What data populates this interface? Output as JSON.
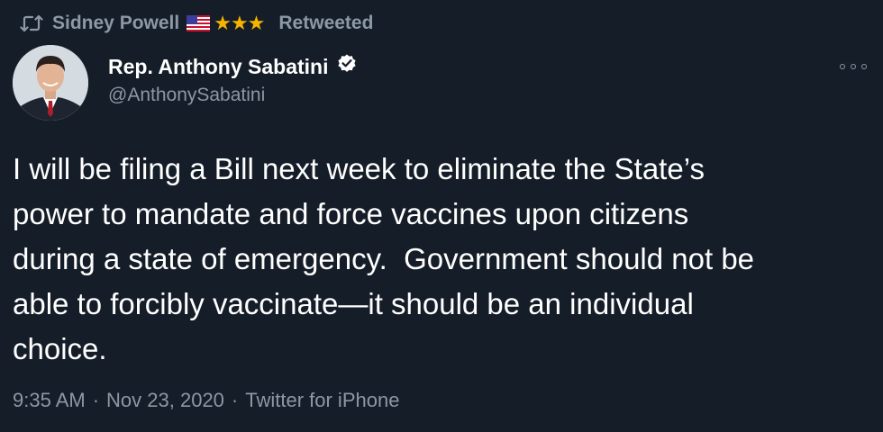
{
  "retweet": {
    "user": "Sidney Powell",
    "stars": "★★★",
    "label": "Retweeted"
  },
  "author": {
    "name": "Rep. Anthony Sabatini",
    "handle": "@AnthonySabatini",
    "verified": true
  },
  "tweet": {
    "text": "I will be filing a Bill next week to eliminate the State’s\npower to mandate and force vaccines upon citizens\nduring a state of emergency.  Government should not be\nable to forcibly vaccinate—it should be an individual\nchoice.",
    "time": "9:35 AM",
    "separator": "·",
    "date": "Nov 23, 2020",
    "source": "Twitter for iPhone"
  },
  "colors": {
    "background": "#151d28",
    "muted": "#8b98a5",
    "verified": "#ffffff",
    "stars": "#f4b400"
  },
  "icons": {
    "retweet": "retweet-icon",
    "flag": "us-flag-icon",
    "verified": "verified-badge-icon",
    "more": "more-options-icon"
  }
}
